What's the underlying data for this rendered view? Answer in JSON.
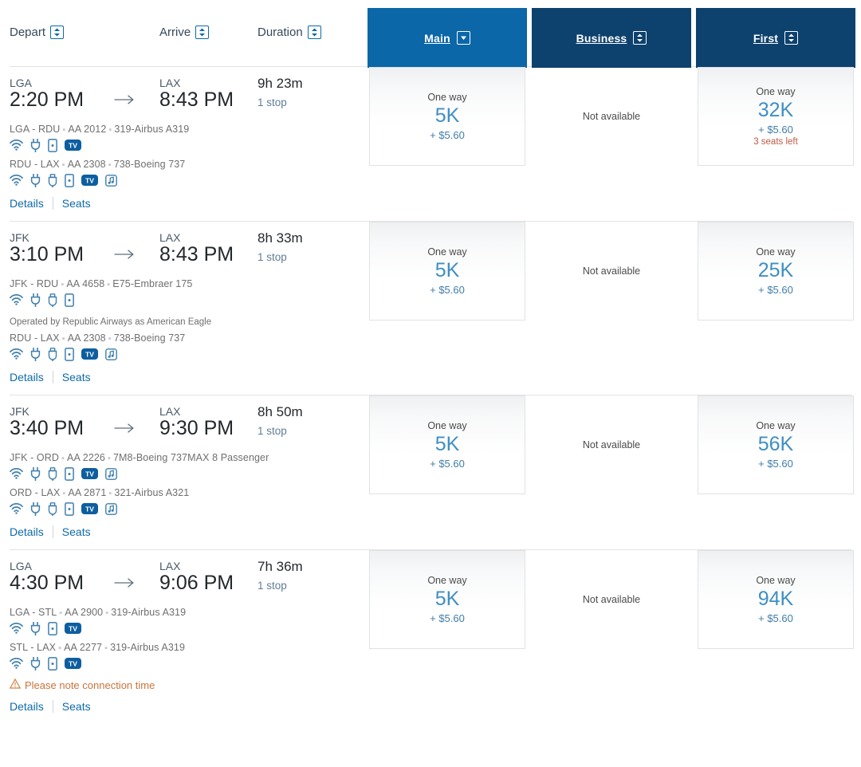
{
  "colors": {
    "tab_active": "#0b67a7",
    "tab_passive": "#0d416e",
    "link": "#0d6aa8",
    "miles": "#3f8fc4",
    "warning": "#c8743c",
    "seats_left": "#c05a43"
  },
  "header": {
    "sort_columns": [
      {
        "label": "Depart",
        "icon": "sort-updown-icon",
        "state": "unsorted"
      },
      {
        "label": "Arrive",
        "icon": "sort-updown-icon",
        "state": "unsorted"
      },
      {
        "label": "Duration",
        "icon": "sort-updown-icon",
        "state": "unsorted"
      }
    ],
    "cabin_tabs": [
      {
        "label": "Main",
        "icon": "sort-down-icon",
        "state": "sorted-desc",
        "active": true
      },
      {
        "label": "Business",
        "icon": "sort-updown-icon",
        "state": "unsorted",
        "active": false
      },
      {
        "label": "First",
        "icon": "sort-updown-icon",
        "state": "unsorted",
        "active": false
      }
    ]
  },
  "links": {
    "details": "Details",
    "seats": "Seats"
  },
  "labels": {
    "one_way": "One way",
    "not_available": "Not available"
  },
  "flights": [
    {
      "depart_airport": "LGA",
      "depart_time": "2:20 PM",
      "arrive_airport": "LAX",
      "arrive_time": "8:43 PM",
      "duration": "9h 23m",
      "stops": "1 stop",
      "operated_by": "",
      "warning": "",
      "segments": [
        {
          "route": "LGA - RDU",
          "flight_number": "AA 2012",
          "aircraft": "319-Airbus A319",
          "amenities": [
            "wifi-icon",
            "power-icon",
            "device-icon",
            "tv-icon"
          ]
        },
        {
          "route": "RDU - LAX",
          "flight_number": "AA 2308",
          "aircraft": "738-Boeing 737",
          "amenities": [
            "wifi-icon",
            "power-icon",
            "usb-icon",
            "device-icon",
            "tv-icon",
            "music-icon"
          ]
        }
      ],
      "fares": [
        {
          "cabin": "Main",
          "available": true,
          "one_way": "One way",
          "miles": "5K",
          "fee": "+ $5.60",
          "seats_left": ""
        },
        {
          "cabin": "Business",
          "available": false,
          "not_available": "Not available"
        },
        {
          "cabin": "First",
          "available": true,
          "one_way": "One way",
          "miles": "32K",
          "fee": "+ $5.60",
          "seats_left": "3 seats left"
        }
      ]
    },
    {
      "depart_airport": "JFK",
      "depart_time": "3:10 PM",
      "arrive_airport": "LAX",
      "arrive_time": "8:43 PM",
      "duration": "8h 33m",
      "stops": "1 stop",
      "operated_by": "Operated by Republic Airways as American Eagle",
      "warning": "",
      "segments": [
        {
          "route": "JFK - RDU",
          "flight_number": "AA 4658",
          "aircraft": "E75-Embraer 175",
          "amenities": [
            "wifi-icon",
            "power-icon",
            "usb-icon",
            "device-icon"
          ]
        },
        {
          "route": "RDU - LAX",
          "flight_number": "AA 2308",
          "aircraft": "738-Boeing 737",
          "amenities": [
            "wifi-icon",
            "power-icon",
            "usb-icon",
            "device-icon",
            "tv-icon",
            "music-icon"
          ]
        }
      ],
      "fares": [
        {
          "cabin": "Main",
          "available": true,
          "one_way": "One way",
          "miles": "5K",
          "fee": "+ $5.60",
          "seats_left": ""
        },
        {
          "cabin": "Business",
          "available": false,
          "not_available": "Not available"
        },
        {
          "cabin": "First",
          "available": true,
          "one_way": "One way",
          "miles": "25K",
          "fee": "+ $5.60",
          "seats_left": ""
        }
      ]
    },
    {
      "depart_airport": "JFK",
      "depart_time": "3:40 PM",
      "arrive_airport": "LAX",
      "arrive_time": "9:30 PM",
      "duration": "8h 50m",
      "stops": "1 stop",
      "operated_by": "",
      "warning": "",
      "segments": [
        {
          "route": "JFK - ORD",
          "flight_number": "AA 2226",
          "aircraft": "7M8-Boeing 737MAX 8 Passenger",
          "amenities": [
            "wifi-icon",
            "power-icon",
            "usb-icon",
            "device-icon",
            "tv-icon",
            "music-icon"
          ]
        },
        {
          "route": "ORD - LAX",
          "flight_number": "AA 2871",
          "aircraft": "321-Airbus A321",
          "amenities": [
            "wifi-icon",
            "power-icon",
            "usb-icon",
            "device-icon",
            "tv-icon",
            "music-icon"
          ]
        }
      ],
      "fares": [
        {
          "cabin": "Main",
          "available": true,
          "one_way": "One way",
          "miles": "5K",
          "fee": "+ $5.60",
          "seats_left": ""
        },
        {
          "cabin": "Business",
          "available": false,
          "not_available": "Not available"
        },
        {
          "cabin": "First",
          "available": true,
          "one_way": "One way",
          "miles": "56K",
          "fee": "+ $5.60",
          "seats_left": ""
        }
      ]
    },
    {
      "depart_airport": "LGA",
      "depart_time": "4:30 PM",
      "arrive_airport": "LAX",
      "arrive_time": "9:06 PM",
      "duration": "7h 36m",
      "stops": "1 stop",
      "operated_by": "",
      "warning": "Please note connection time",
      "segments": [
        {
          "route": "LGA - STL",
          "flight_number": "AA 2900",
          "aircraft": "319-Airbus A319",
          "amenities": [
            "wifi-icon",
            "power-icon",
            "device-icon",
            "tv-icon"
          ]
        },
        {
          "route": "STL - LAX",
          "flight_number": "AA 2277",
          "aircraft": "319-Airbus A319",
          "amenities": [
            "wifi-icon",
            "power-icon",
            "device-icon",
            "tv-icon"
          ]
        }
      ],
      "fares": [
        {
          "cabin": "Main",
          "available": true,
          "one_way": "One way",
          "miles": "5K",
          "fee": "+ $5.60",
          "seats_left": ""
        },
        {
          "cabin": "Business",
          "available": false,
          "not_available": "Not available"
        },
        {
          "cabin": "First",
          "available": true,
          "one_way": "One way",
          "miles": "94K",
          "fee": "+ $5.60",
          "seats_left": ""
        }
      ]
    }
  ]
}
